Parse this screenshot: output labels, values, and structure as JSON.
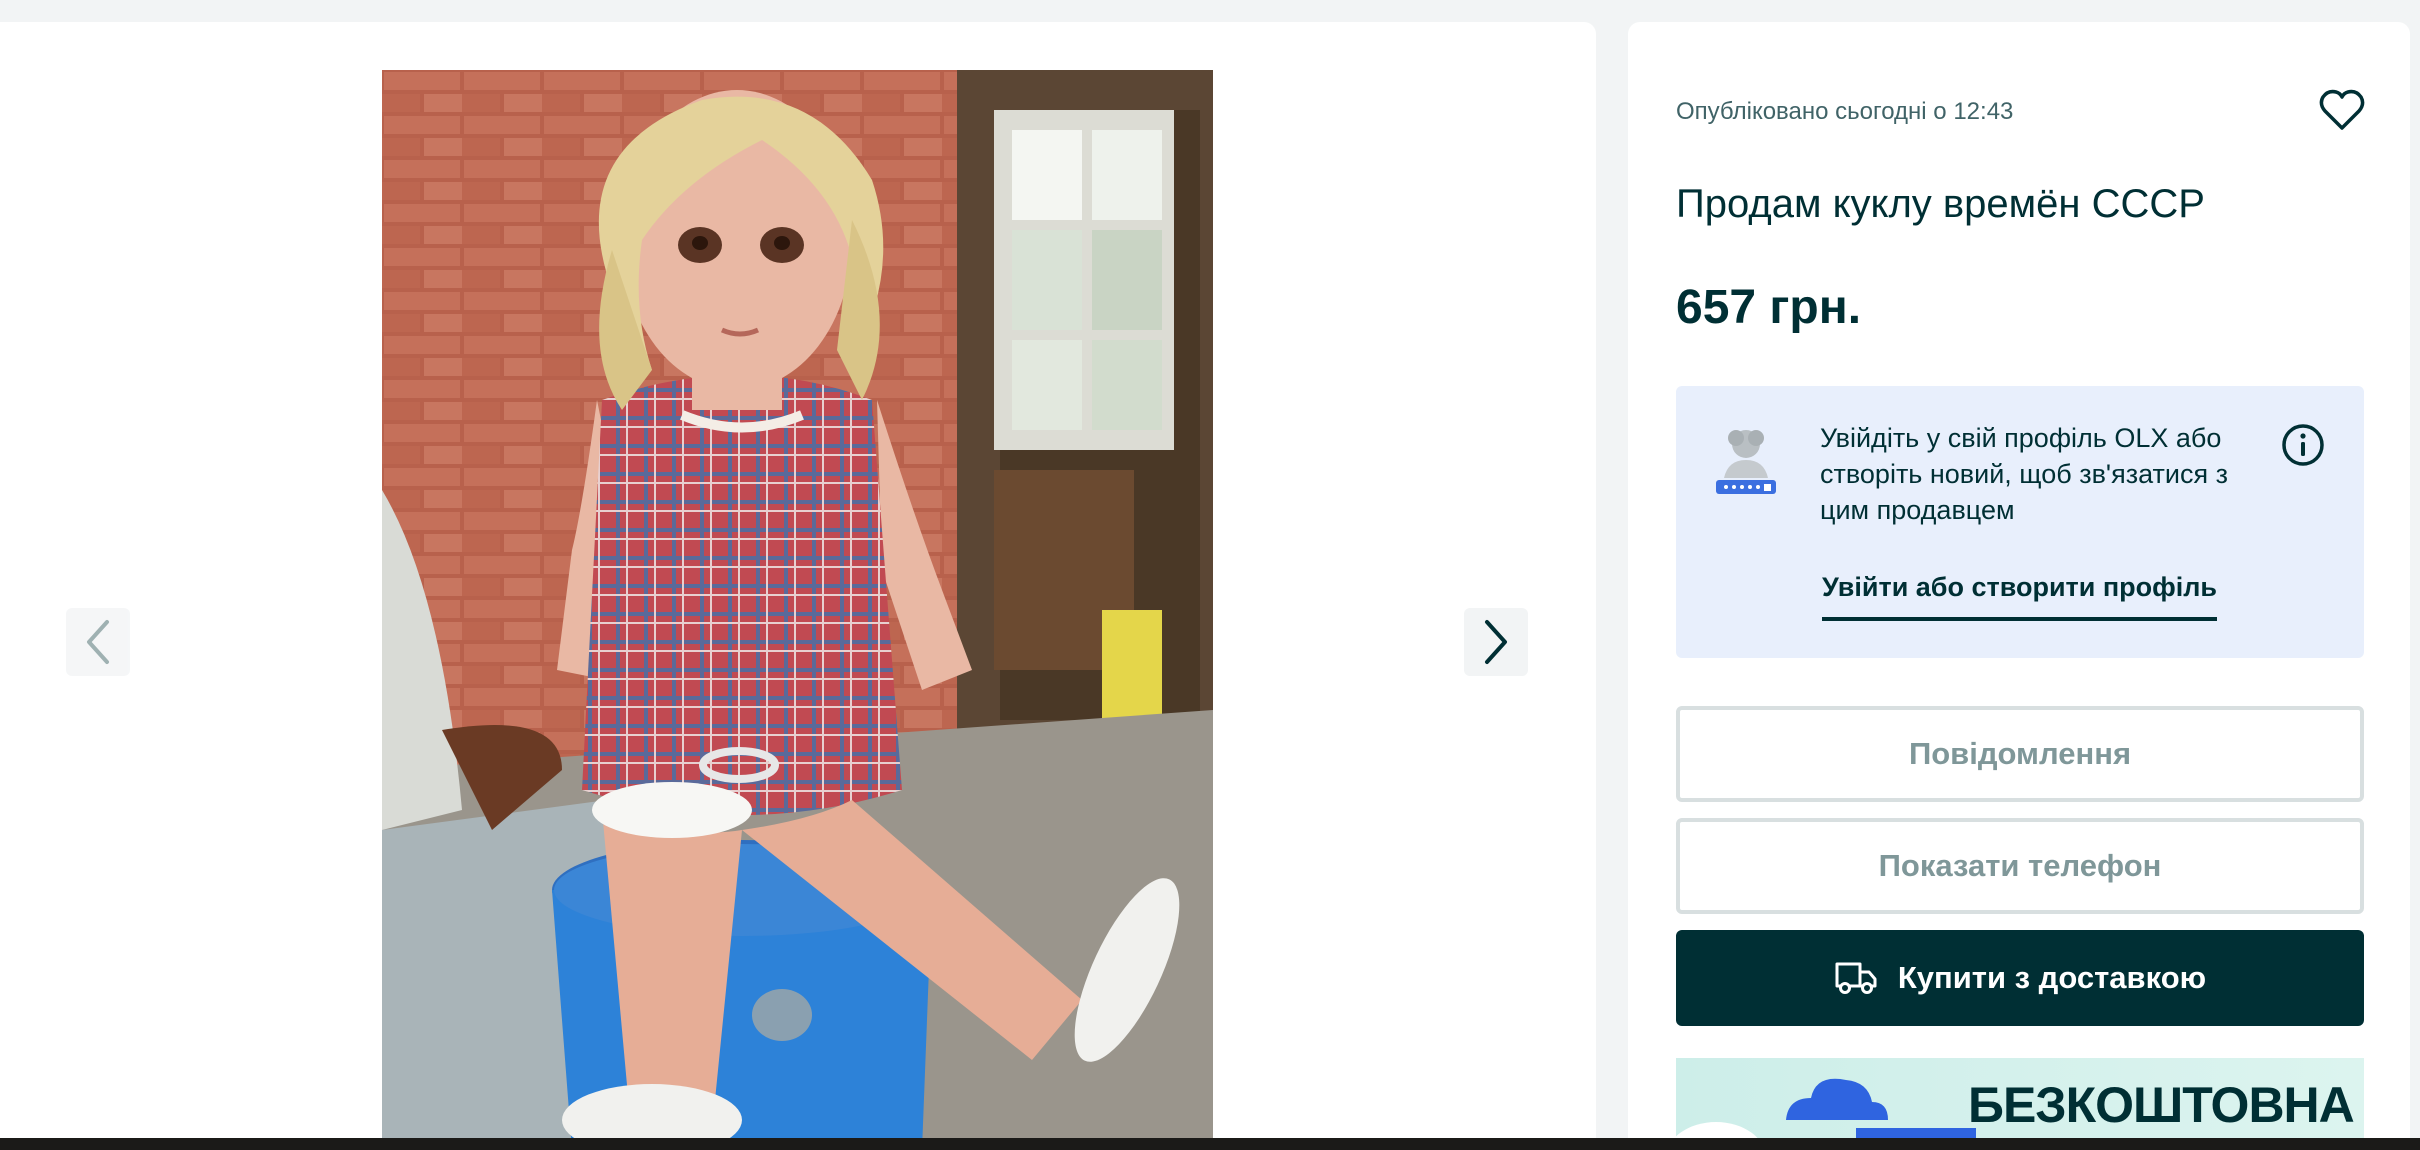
{
  "listing": {
    "posted_label": "Опубліковано сьогодні о 12:43",
    "title": "Продам куклу времён СССР",
    "price": "657 грн."
  },
  "login_prompt": {
    "message": "Увійдіть у свій профіль OLX або створіть новий, щоб зв'язатися з цим продавцем",
    "link_label": "Увійти або створити профіль"
  },
  "actions": {
    "message_label": "Повідомлення",
    "phone_label": "Показати телефон",
    "buy_label": "Купити з доставкою"
  },
  "promo": {
    "text": "БЕЗКОШТОВНА"
  },
  "icons": {
    "favorite": "heart-icon",
    "info": "info-icon",
    "delivery": "truck-icon",
    "prev": "chevron-left-icon",
    "next": "chevron-right-icon"
  },
  "colors": {
    "brand_dark": "#002f34",
    "login_bg": "#e8effc",
    "page_bg": "#f2f4f5",
    "outline_border": "#d8dfe0"
  }
}
